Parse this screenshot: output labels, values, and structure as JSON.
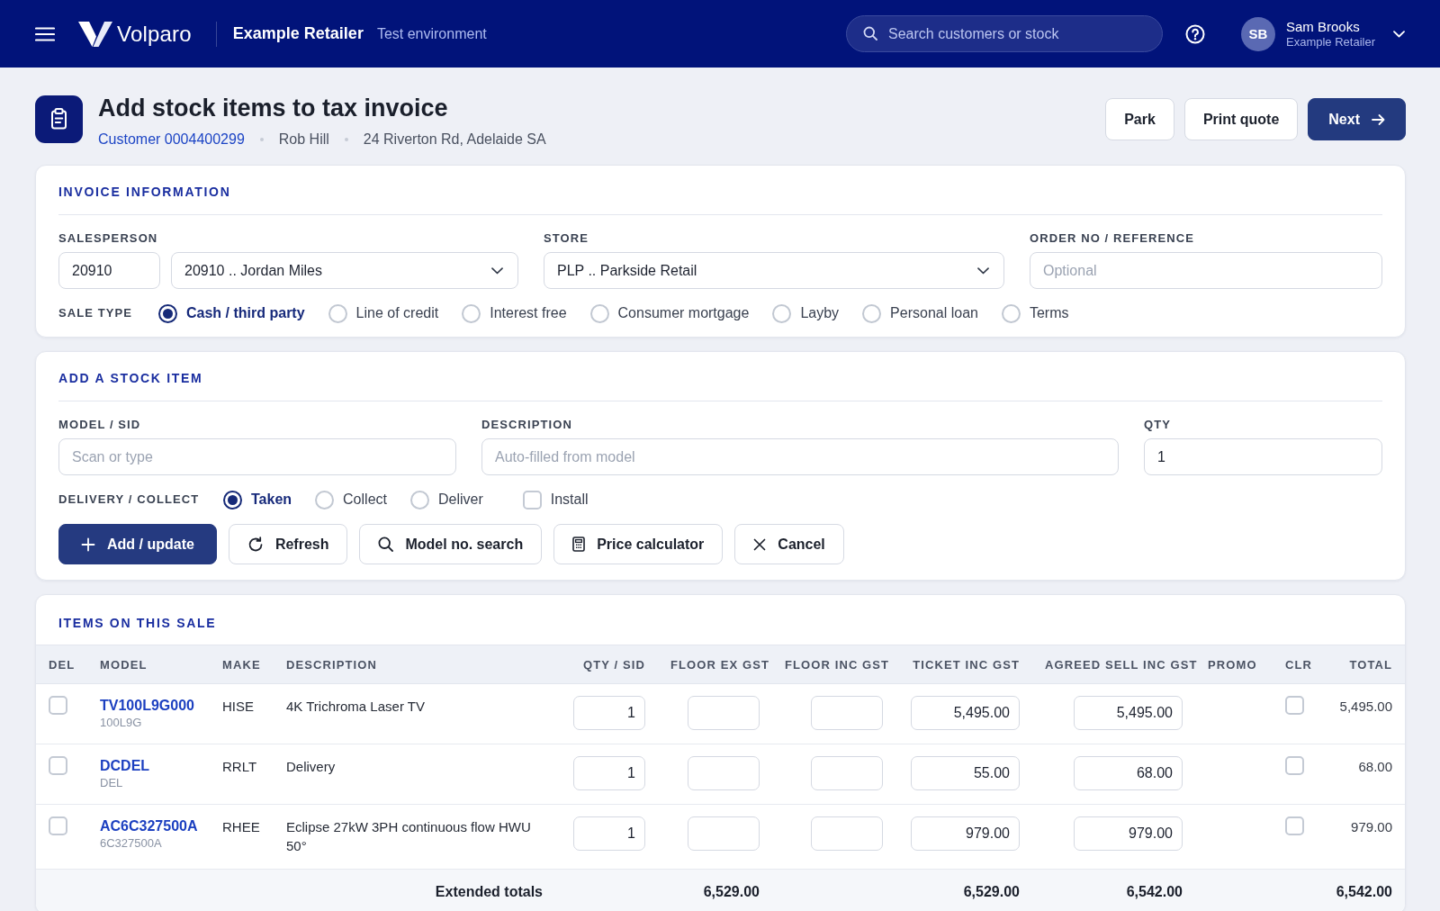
{
  "header": {
    "brand": "Volparo",
    "retailer": "Example Retailer",
    "environment": "Test environment",
    "search": {
      "placeholder": "Search customers or stock"
    },
    "user": {
      "initials": "SB",
      "name": "Sam Brooks",
      "organisation": "Example Retailer"
    }
  },
  "page": {
    "title": "Add stock items to tax invoice",
    "customer": "Customer 0004400299",
    "customer_name": "Rob Hill",
    "address": "24 Riverton Rd, Adelaide SA",
    "actions": [
      {
        "label": "Park",
        "kind": "secondary"
      },
      {
        "label": "Print quote",
        "kind": "secondary"
      },
      {
        "label": "Next",
        "kind": "primary"
      }
    ]
  },
  "invoice_information": {
    "title": "INVOICE INFORMATION",
    "salesperson": {
      "label": "SALESPERSON",
      "code": "20910",
      "name": "20910 .. Jordan Miles"
    },
    "store": {
      "label": "STORE",
      "value": "PLP .. Parkside Retail"
    },
    "order_reference": {
      "label": "ORDER NO / REFERENCE",
      "placeholder": "Optional"
    },
    "sale_type": {
      "label": "SALE TYPE",
      "options": [
        {
          "label": "Cash / third party",
          "selected": true
        },
        {
          "label": "Line of credit",
          "selected": false
        },
        {
          "label": "Interest free",
          "selected": false
        },
        {
          "label": "Consumer mortgage",
          "selected": false
        },
        {
          "label": "Layby",
          "selected": false
        },
        {
          "label": "Personal loan",
          "selected": false
        },
        {
          "label": "Terms",
          "selected": false
        }
      ]
    }
  },
  "add_stock_item": {
    "title": "ADD A STOCK ITEM",
    "model": {
      "label": "MODEL / SID",
      "placeholder": "Scan or type"
    },
    "description": {
      "label": "DESCRIPTION",
      "placeholder": "Auto-filled from model"
    },
    "qty": {
      "label": "QTY",
      "value": "1"
    },
    "delivery": {
      "label": "DELIVERY / COLLECT",
      "options": [
        {
          "label": "Taken",
          "kind": "radio",
          "selected": true
        },
        {
          "label": "Collect",
          "kind": "radio",
          "selected": false
        },
        {
          "label": "Deliver",
          "kind": "radio",
          "selected": false
        },
        {
          "label": "Install",
          "kind": "checkbox",
          "checked": false
        }
      ]
    },
    "buttons": [
      {
        "label": "Add / update",
        "kind": "primary"
      },
      {
        "label": "Refresh",
        "kind": "secondary"
      },
      {
        "label": "Model no. search",
        "kind": "secondary"
      },
      {
        "label": "Price calculator",
        "kind": "secondary"
      },
      {
        "label": "Cancel",
        "kind": "secondary"
      }
    ]
  },
  "items": {
    "title": "ITEMS ON THIS SALE",
    "columns": [
      "DEL",
      "MODEL",
      "MAKE",
      "DESCRIPTION",
      "QTY / SID",
      "FLOOR EX GST",
      "FLOOR INC GST",
      "TICKET INC GST",
      "AGREED SELL INC GST",
      "PROMO",
      "CLR",
      "TOTAL"
    ],
    "rows": [
      {
        "del": false,
        "model": "TV100L9G000",
        "sid": "100L9G",
        "make": "HISE",
        "description": "4K Trichroma Laser TV",
        "qty": "1",
        "ticket_inc_gst": "5,495.00",
        "agreed_sell_inc_gst": "5,495.00",
        "clr": false,
        "total": "5,495.00"
      },
      {
        "del": false,
        "model": "DCDEL",
        "sid": "DEL",
        "make": "RRLT",
        "description": "Delivery",
        "qty": "1",
        "ticket_inc_gst": "55.00",
        "agreed_sell_inc_gst": "68.00",
        "clr": false,
        "total": "68.00"
      },
      {
        "del": false,
        "model": "AC6C327500A",
        "sid": "6C327500A",
        "make": "RHEE",
        "description": "Eclipse 27kW 3PH continuous flow HWU 50°",
        "qty": "1",
        "ticket_inc_gst": "979.00",
        "agreed_sell_inc_gst": "979.00",
        "clr": false,
        "total": "979.00"
      }
    ],
    "totals": {
      "label": "Extended totals",
      "floor_ex_gst": "6,529.00",
      "ticket_inc_gst": "6,529.00",
      "agreed_sell_inc_gst": "6,542.00",
      "total": "6,542.00"
    }
  }
}
